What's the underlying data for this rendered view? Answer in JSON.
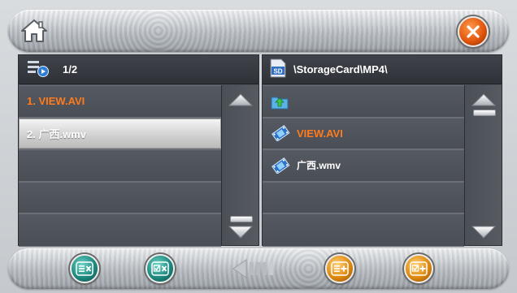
{
  "header": {
    "home_icon": "home-icon",
    "close_icon": "close-icon"
  },
  "left_panel": {
    "page_indicator": "1/2",
    "playlist_icon": "playlist-icon",
    "items": [
      {
        "label": "1. VIEW.AVI",
        "state": "playing",
        "color": "#ff7b1c"
      },
      {
        "label": "2. 广西.wmv",
        "state": "selected"
      },
      {
        "label": ""
      },
      {
        "label": ""
      },
      {
        "label": ""
      }
    ]
  },
  "right_panel": {
    "path": "\\StorageCard\\MP4\\",
    "sd_icon": "sd-card-icon",
    "items": [
      {
        "label": "",
        "icon": "folder-up-icon"
      },
      {
        "label": "VIEW.AVI",
        "icon": "video-file-icon",
        "color": "#ff7b1c"
      },
      {
        "label": "广西.wmv",
        "icon": "video-file-icon"
      },
      {
        "label": ""
      },
      {
        "label": ""
      }
    ]
  },
  "bottom_bar": {
    "buttons": [
      {
        "name": "remove-from-list-button",
        "icon": "list-remove-icon",
        "color": "#1e8a7f"
      },
      {
        "name": "remove-selected-button",
        "icon": "checkbox-remove-icon",
        "color": "#1e8a7f"
      },
      {
        "name": "back-button",
        "icon": "back-arrow-icon"
      },
      {
        "name": "add-to-list-button",
        "icon": "list-add-icon",
        "color": "#e08a10"
      },
      {
        "name": "add-selected-button",
        "icon": "checkbox-add-icon",
        "color": "#e08a10"
      }
    ]
  },
  "colors": {
    "accent_orange": "#ff7b1c",
    "panel_bg": "#4d5158",
    "header_bg": "#2f3238"
  }
}
